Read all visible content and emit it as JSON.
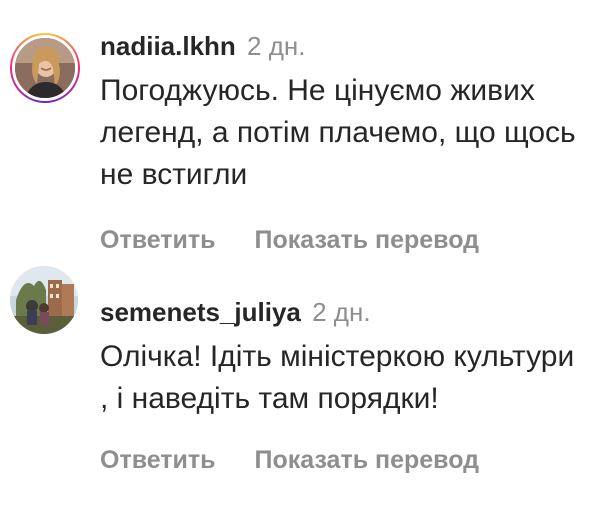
{
  "comments": [
    {
      "username": "nadiia.lkhn",
      "time": "2 дн.",
      "text": "Погоджуюсь. Не цінуємо живих легенд, а потім плачемо, що щось не встигли",
      "reply_label": "Ответить",
      "translate_label": "Показать перевод",
      "avatar": "profile-photo-with-story-ring"
    },
    {
      "username": "semenets_juliya",
      "time": "2 дн.",
      "text": "Олічка! Ідіть міністеркою культури , і наведіть там порядки!",
      "reply_label": "Ответить",
      "translate_label": "Показать перевод",
      "avatar": "profile-photo"
    }
  ],
  "colors": {
    "text": "#262626",
    "secondary": "#8e8e8e",
    "background": "#ffffff",
    "story_ring": [
      "#f9ce34",
      "#ee2a7b",
      "#6228d7"
    ]
  }
}
